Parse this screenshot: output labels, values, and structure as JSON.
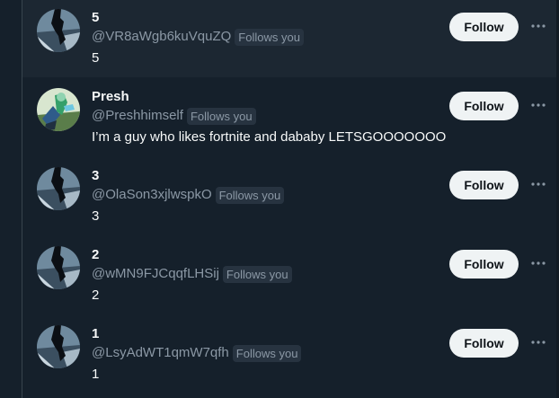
{
  "colors": {
    "background": "#15202b",
    "hover_row": "#1c2732",
    "text_primary": "#f7f9f9",
    "text_secondary": "#8b98a5",
    "badge_bg": "#273340",
    "follow_bg": "#eff3f4"
  },
  "users": [
    {
      "name": "5",
      "handle": "@VR8aWgb6kuVquZQ",
      "badge": "Follows you",
      "bio": "5",
      "follow_label": "Follow",
      "avatar": "silhouette-avatar"
    },
    {
      "name": "Presh",
      "handle": "@Preshhimself",
      "badge": "Follows you",
      "bio": "I’m a guy who likes fortnite and dababy LETSGOOOOOOO",
      "follow_label": "Follow",
      "avatar": "game-character-avatar"
    },
    {
      "name": "3",
      "handle": "@OlaSon3xjlwspkO",
      "badge": "Follows you",
      "bio": "3",
      "follow_label": "Follow",
      "avatar": "silhouette-avatar"
    },
    {
      "name": "2",
      "handle": "@wMN9FJCqqfLHSij",
      "badge": "Follows you",
      "bio": "2",
      "follow_label": "Follow",
      "avatar": "silhouette-avatar"
    },
    {
      "name": "1",
      "handle": "@LsyAdWT1qmW7qfh",
      "badge": "Follows you",
      "bio": "1",
      "follow_label": "Follow",
      "avatar": "silhouette-avatar"
    }
  ]
}
